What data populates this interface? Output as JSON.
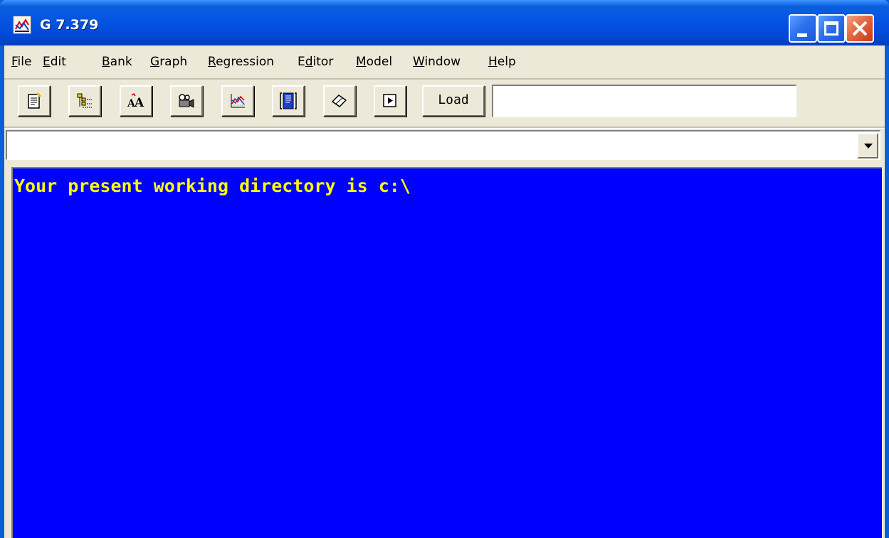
{
  "window": {
    "title": "G 7.379",
    "icon": "app-chart-icon"
  },
  "menu": [
    {
      "label": "File",
      "ul": "F",
      "rest": "ile"
    },
    {
      "label": "Edit",
      "ul": "E",
      "rest": "dit"
    },
    {
      "label": "Bank",
      "ul": "B",
      "rest": "ank"
    },
    {
      "label": "Graph",
      "ul": "G",
      "rest": "raph"
    },
    {
      "label": "Regression",
      "ul": "R",
      "rest": "egression"
    },
    {
      "label": "Editor",
      "pre": "E",
      "ul": "d",
      "rest": "itor"
    },
    {
      "label": "Model",
      "ul": "M",
      "rest": "odel"
    },
    {
      "label": "Window",
      "ul": "W",
      "rest": "indow"
    },
    {
      "label": "Help",
      "ul": "H",
      "rest": "elp"
    }
  ],
  "toolbar": {
    "buttons": [
      "new-document-icon",
      "tree-list-icon",
      "font-size-icon",
      "camera-icon",
      "graph-icon",
      "editor-panel-icon",
      "eraser-icon",
      "run-icon"
    ],
    "load_label": "Load",
    "load_value": ""
  },
  "command": {
    "value": ""
  },
  "console": {
    "text_color": "#ffff00",
    "background": "#0000ff",
    "lines": [
      "Your present working directory is c:\\"
    ]
  }
}
